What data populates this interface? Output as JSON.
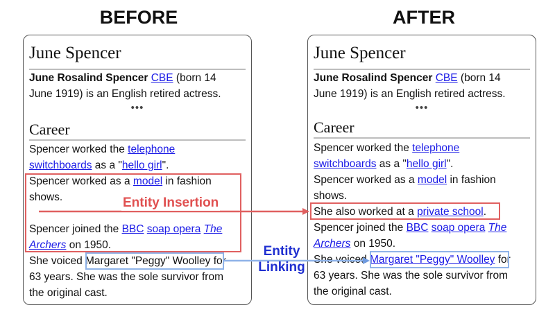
{
  "before": {
    "heading": "BEFORE",
    "title": "June Spencer",
    "intro_bold": "June Rosalind Spencer",
    "intro_link": "CBE",
    "intro_rest_1": " (born 14",
    "intro_rest_2": "June 1919) is an English retired actress.",
    "dots": "•••",
    "section": "Career",
    "p1_a": "Spencer worked the ",
    "p1_link1": "telephone",
    "p1_link2": "switchboards",
    "p1_b": " as a \"",
    "p1_link3": "hello girl",
    "p1_c": "\".",
    "p2_a": "Spencer worked as a ",
    "p2_link": "model",
    "p2_b": " in fashion",
    "p2_c": "shows.",
    "p3_a": "Spencer joined the ",
    "p3_link1": "BBC",
    "p3_link2": "soap opera",
    "p3_link3": "The",
    "p3_link4": "Archers",
    "p3_b": " on 1950.",
    "p4_a": "She voiced ",
    "p4_plain": "Margaret \"Peggy\" Woolley",
    "p4_b": " for",
    "p4_c": "63 years. She was the sole survivor from",
    "p4_d": "the original cast."
  },
  "after": {
    "heading": "AFTER",
    "title": "June Spencer",
    "intro_bold": "June Rosalind Spencer",
    "intro_link": "CBE",
    "intro_rest_1": " (born 14",
    "intro_rest_2": "June 1919) is an English retired actress.",
    "dots": "•••",
    "section": "Career",
    "p1_a": "Spencer worked the ",
    "p1_link1": "telephone",
    "p1_link2": "switchboards",
    "p1_b": " as a \"",
    "p1_link3": "hello girl",
    "p1_c": "\".",
    "p2_a": "Spencer worked as a ",
    "p2_link": "model",
    "p2_b": " in fashion",
    "p2_c": "shows.",
    "inserted_a": "She also worked at a ",
    "inserted_link": "private school",
    "inserted_b": ".",
    "p3_a": "Spencer joined the ",
    "p3_link1": "BBC",
    "p3_link2": "soap opera",
    "p3_link3": "The",
    "p3_link4": "Archers",
    "p3_b": " on 1950.",
    "p4_a": "She voiced ",
    "p4_link": "Margaret \"Peggy\" Woolley",
    "p4_b": " for",
    "p4_c": "63 years. She was the sole survivor from",
    "p4_d": "the original cast."
  },
  "labels": {
    "insertion": "Entity Insertion",
    "linking_1": "Entity",
    "linking_2": "Linking"
  },
  "colors": {
    "insertion": "#e06060",
    "linking_box": "#8fb3e8",
    "linking_label": "#1f2fd0",
    "link": "#1a1ae6"
  }
}
